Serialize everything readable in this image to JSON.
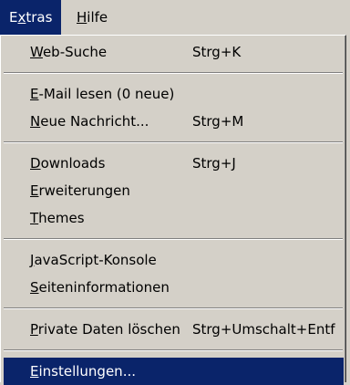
{
  "menubar": {
    "items": [
      {
        "pre": "E",
        "mn": "x",
        "post": "tras"
      },
      {
        "pre": "",
        "mn": "H",
        "post": "ilfe"
      }
    ]
  },
  "menu": {
    "web_search": {
      "pre": "",
      "mn": "W",
      "post": "eb-Suche",
      "shortcut": "Strg+K"
    },
    "read_mail": {
      "pre": "",
      "mn": "E",
      "post": "-Mail lesen (0 neue)"
    },
    "new_message": {
      "pre": "",
      "mn": "N",
      "post": "eue Nachricht...",
      "shortcut": "Strg+M"
    },
    "downloads": {
      "pre": "",
      "mn": "D",
      "post": "ownloads",
      "shortcut": "Strg+J"
    },
    "extensions": {
      "pre": "",
      "mn": "E",
      "post": "rweiterungen"
    },
    "themes": {
      "pre": "",
      "mn": "T",
      "post": "hemes"
    },
    "js_console": {
      "pre": "",
      "mn": "J",
      "post": "avaScript-Konsole"
    },
    "page_info": {
      "pre": "",
      "mn": "S",
      "post": "eiteninformationen"
    },
    "clear_private": {
      "pre": "",
      "mn": "P",
      "post": "rivate Daten löschen",
      "shortcut": "Strg+Umschalt+Entf"
    },
    "settings": {
      "pre": "",
      "mn": "E",
      "post": "instellungen..."
    }
  }
}
